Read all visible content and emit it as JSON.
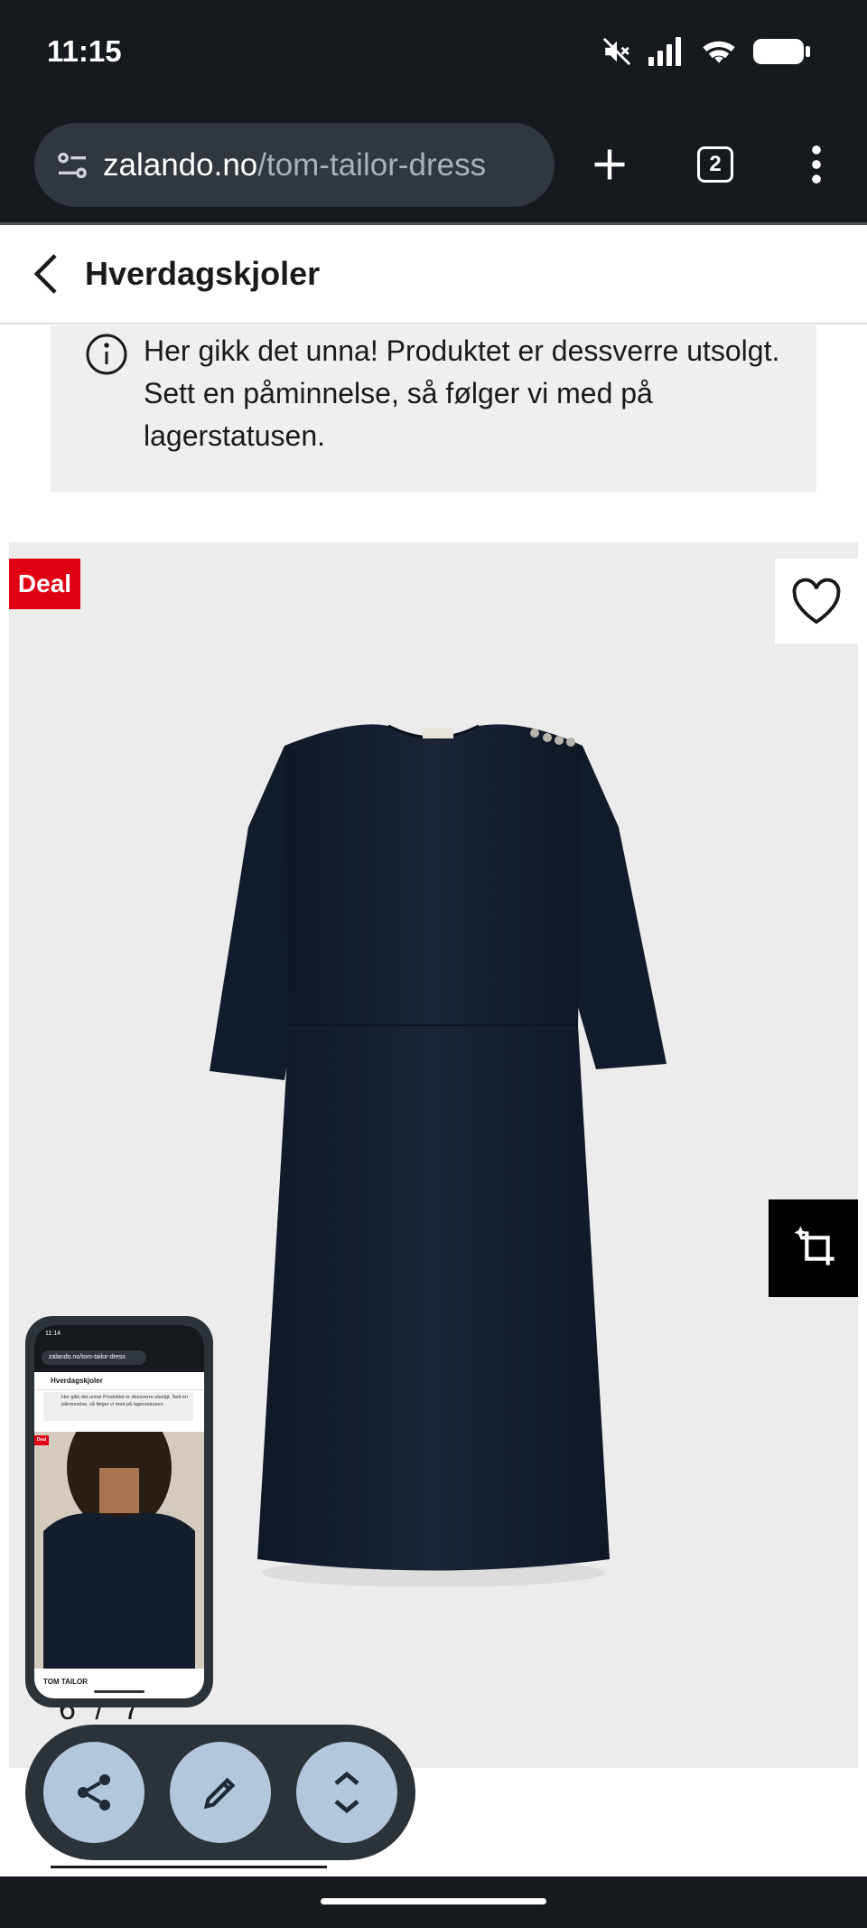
{
  "status_bar": {
    "time": "11:15"
  },
  "browser": {
    "url_domain": "zalando.no",
    "url_path": "/tom-tailor-dress",
    "tab_count": "2"
  },
  "header": {
    "title": "Hverdagskjoler"
  },
  "notice": {
    "text": "Her gikk det unna! Produktet er dessverre utsolgt. Sett en påminnelse, så følger vi med på lagerstatusen."
  },
  "product": {
    "deal_label": "Deal",
    "image_counter": "6 / 7",
    "dress_color": "#141d2b"
  },
  "thumbnail": {
    "time": "11:14",
    "url": "zalando.no/tom-tailor-dress",
    "header": "Hverdagskjoler",
    "notice": "Her gikk det unna! Produktet er dessverre utsolgt. Sett en påminnelse, så følger vi med på lagerstatusen.",
    "deal": "Deal",
    "brand": "TOM TAILOR"
  },
  "colors": {
    "deal_red": "#e00014",
    "chrome_bg": "#161a1e",
    "pill_bg": "#2b3238",
    "action_btn": "#b3c7dc"
  }
}
